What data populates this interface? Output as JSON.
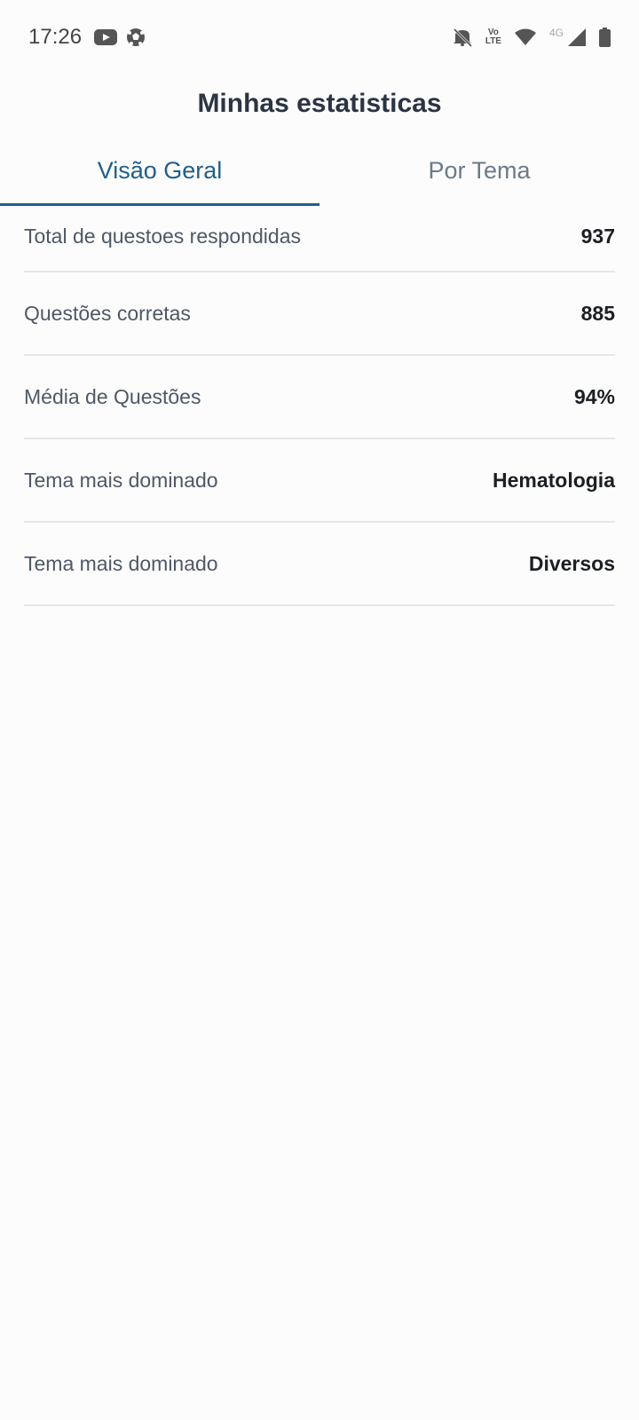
{
  "status_bar": {
    "time": "17:26",
    "network_label": "4G",
    "lte_top": "Vo",
    "lte_bottom": "LTE",
    "icons": [
      "youtube-icon",
      "soccer-ball-icon",
      "mute-icon",
      "volte-icon",
      "wifi-icon",
      "signal-icon",
      "battery-icon"
    ]
  },
  "header": {
    "title": "Minhas estatisticas"
  },
  "tabs": [
    {
      "label": "Visão Geral",
      "active": true
    },
    {
      "label": "Por Tema",
      "active": false
    }
  ],
  "stats": [
    {
      "label": "Total de questoes respondidas",
      "value": "937"
    },
    {
      "label": "Questões corretas",
      "value": "885"
    },
    {
      "label": "Média de Questões",
      "value": "94%"
    },
    {
      "label": "Tema mais dominado",
      "value": "Hematologia"
    },
    {
      "label": "Tema mais dominado",
      "value": "Diversos"
    }
  ],
  "colors": {
    "accent": "#1f5f8b",
    "title": "#2b3443",
    "background": "#fcfcfc"
  }
}
